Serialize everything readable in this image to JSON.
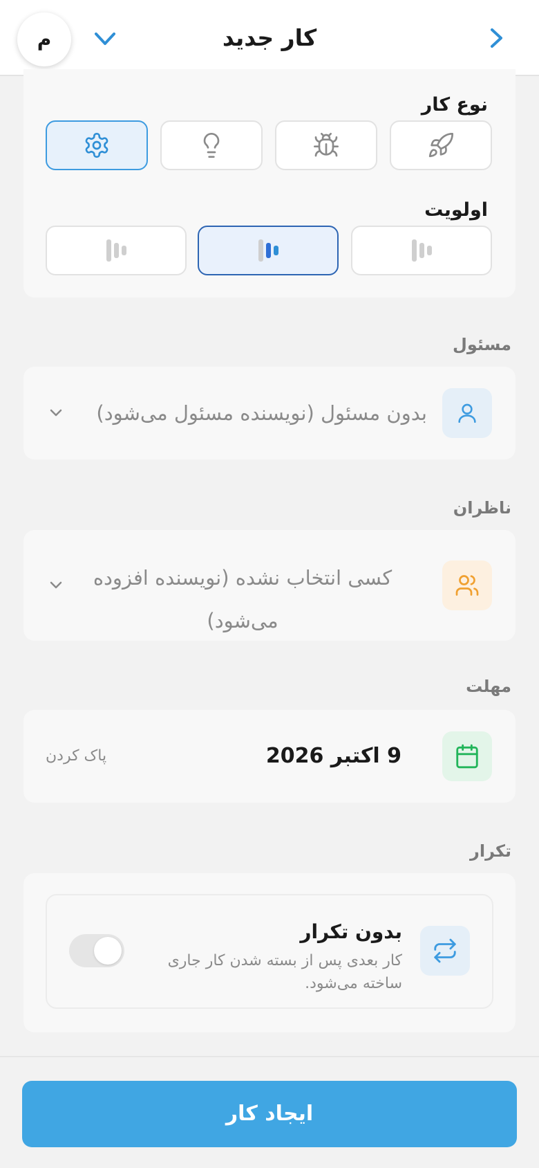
{
  "header": {
    "title": "کار جدید",
    "avatar_initial": "م"
  },
  "task_type": {
    "label": "نوع کار",
    "options": [
      {
        "icon": "rocket-icon",
        "selected": false
      },
      {
        "icon": "bug-icon",
        "selected": false
      },
      {
        "icon": "lightbulb-icon",
        "selected": false
      },
      {
        "icon": "gear-icon",
        "selected": true
      }
    ]
  },
  "priority": {
    "label": "اولویت",
    "options": [
      {
        "icon": "priority-low-icon",
        "selected": false
      },
      {
        "icon": "priority-medium-icon",
        "selected": true
      },
      {
        "icon": "priority-high-icon",
        "selected": false
      }
    ]
  },
  "assignee": {
    "label": "مسئول",
    "value": "بدون مسئول (نویسنده مسئول می‌شود)",
    "icon": "user-icon"
  },
  "watchers": {
    "label": "ناظران",
    "value": "کسی انتخاب نشده (نویسنده افزوده می‌شود)",
    "icon": "users-icon"
  },
  "deadline": {
    "label": "مهلت",
    "value": "9 اکتبر 2026",
    "clear_label": "پاک کردن",
    "icon": "calendar-icon"
  },
  "repeat": {
    "label": "تکرار",
    "title": "بدون تکرار",
    "description": "کار بعدی پس از بسته شدن کار جاری ساخته می‌شود.",
    "enabled": false,
    "icon": "repeat-icon"
  },
  "footer": {
    "create_label": "ایجاد کار"
  },
  "colors": {
    "accent": "#40a6e3",
    "selected_border": "#3d9be0",
    "priority_selected": "#2d65b3",
    "assignee_icon": "#3d9be0",
    "watchers_icon": "#f0a030",
    "calendar_icon": "#22b55a"
  }
}
